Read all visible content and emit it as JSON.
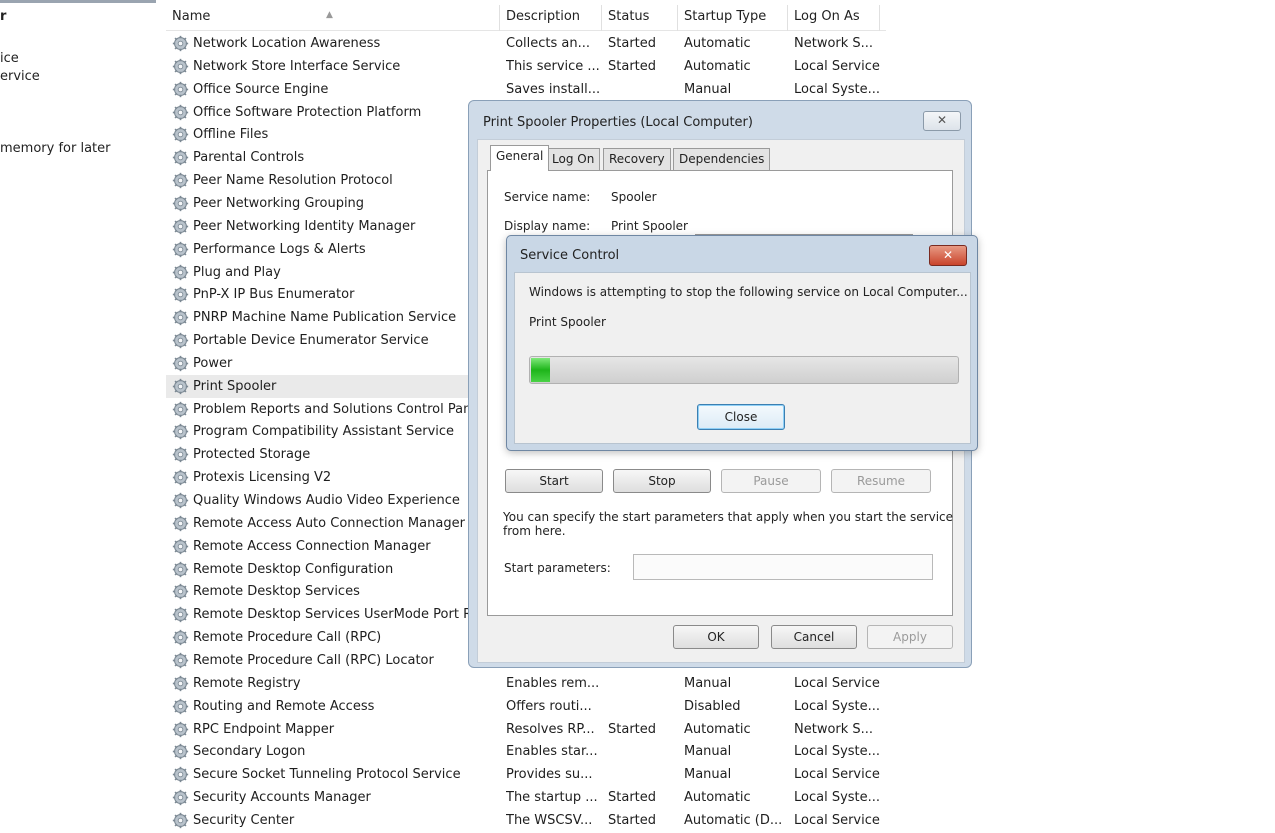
{
  "left_pane": {
    "heading": "r",
    "line1": "ice",
    "line2": "ervice",
    "line3": " memory for later"
  },
  "columns": [
    "Name",
    "Description",
    "Status",
    "Startup Type",
    "Log On As"
  ],
  "services": [
    {
      "name": "Network Location Awareness",
      "description": "Collects an...",
      "status": "Started",
      "startup": "Automatic",
      "logon": "Network S..."
    },
    {
      "name": "Network Store Interface Service",
      "description": "This service ...",
      "status": "Started",
      "startup": "Automatic",
      "logon": "Local Service"
    },
    {
      "name": "Office  Source Engine",
      "description": "Saves install...",
      "status": "",
      "startup": "Manual",
      "logon": "Local Syste..."
    },
    {
      "name": "Office Software Protection Platform",
      "description": "",
      "status": "",
      "startup": "",
      "logon": ""
    },
    {
      "name": "Offline Files",
      "description": "",
      "status": "",
      "startup": "",
      "logon": ""
    },
    {
      "name": "Parental Controls",
      "description": "",
      "status": "",
      "startup": "",
      "logon": ""
    },
    {
      "name": "Peer Name Resolution Protocol",
      "description": "",
      "status": "",
      "startup": "",
      "logon": ""
    },
    {
      "name": "Peer Networking Grouping",
      "description": "",
      "status": "",
      "startup": "",
      "logon": ""
    },
    {
      "name": "Peer Networking Identity Manager",
      "description": "",
      "status": "",
      "startup": "",
      "logon": ""
    },
    {
      "name": "Performance Logs & Alerts",
      "description": "",
      "status": "",
      "startup": "",
      "logon": ""
    },
    {
      "name": "Plug and Play",
      "description": "",
      "status": "",
      "startup": "",
      "logon": ""
    },
    {
      "name": "PnP-X IP Bus Enumerator",
      "description": "",
      "status": "",
      "startup": "",
      "logon": ""
    },
    {
      "name": "PNRP Machine Name Publication Service",
      "description": "",
      "status": "",
      "startup": "",
      "logon": ""
    },
    {
      "name": "Portable Device Enumerator Service",
      "description": "",
      "status": "",
      "startup": "",
      "logon": ""
    },
    {
      "name": "Power",
      "description": "",
      "status": "",
      "startup": "",
      "logon": ""
    },
    {
      "name": "Print Spooler",
      "description": "",
      "status": "",
      "startup": "",
      "logon": "",
      "selected": true
    },
    {
      "name": "Problem Reports and Solutions Control Pan",
      "description": "",
      "status": "",
      "startup": "",
      "logon": ""
    },
    {
      "name": "Program Compatibility Assistant Service",
      "description": "",
      "status": "",
      "startup": "",
      "logon": ""
    },
    {
      "name": "Protected Storage",
      "description": "",
      "status": "",
      "startup": "",
      "logon": ""
    },
    {
      "name": "Protexis Licensing V2",
      "description": "",
      "status": "",
      "startup": "",
      "logon": ""
    },
    {
      "name": "Quality Windows Audio Video Experience",
      "description": "",
      "status": "",
      "startup": "",
      "logon": ""
    },
    {
      "name": "Remote Access Auto Connection Manager",
      "description": "",
      "status": "",
      "startup": "",
      "logon": ""
    },
    {
      "name": "Remote Access Connection Manager",
      "description": "",
      "status": "",
      "startup": "",
      "logon": ""
    },
    {
      "name": "Remote Desktop Configuration",
      "description": "",
      "status": "",
      "startup": "",
      "logon": ""
    },
    {
      "name": "Remote Desktop Services",
      "description": "",
      "status": "",
      "startup": "",
      "logon": ""
    },
    {
      "name": "Remote Desktop Services UserMode Port Re",
      "description": "",
      "status": "",
      "startup": "",
      "logon": ""
    },
    {
      "name": "Remote Procedure Call (RPC)",
      "description": "",
      "status": "",
      "startup": "",
      "logon": ""
    },
    {
      "name": "Remote Procedure Call (RPC) Locator",
      "description": "",
      "status": "",
      "startup": "",
      "logon": ""
    },
    {
      "name": "Remote Registry",
      "description": "Enables rem...",
      "status": "",
      "startup": "Manual",
      "logon": "Local Service"
    },
    {
      "name": "Routing and Remote Access",
      "description": "Offers routi...",
      "status": "",
      "startup": "Disabled",
      "logon": "Local Syste..."
    },
    {
      "name": "RPC Endpoint Mapper",
      "description": "Resolves RP...",
      "status": "Started",
      "startup": "Automatic",
      "logon": "Network S..."
    },
    {
      "name": "Secondary Logon",
      "description": "Enables star...",
      "status": "",
      "startup": "Manual",
      "logon": "Local Syste..."
    },
    {
      "name": "Secure Socket Tunneling Protocol Service",
      "description": "Provides su...",
      "status": "",
      "startup": "Manual",
      "logon": "Local Service"
    },
    {
      "name": "Security Accounts Manager",
      "description": "The startup ...",
      "status": "Started",
      "startup": "Automatic",
      "logon": "Local Syste..."
    },
    {
      "name": "Security Center",
      "description": "The WSCSV...",
      "status": "Started",
      "startup": "Automatic (D...",
      "logon": "Local Service"
    }
  ],
  "properties_dialog": {
    "title": "Print Spooler Properties (Local Computer)",
    "close_glyph": "✕",
    "tabs": [
      "General",
      "Log On",
      "Recovery",
      "Dependencies"
    ],
    "service_name_label": "Service name:",
    "service_name_value": "Spooler",
    "display_name_label": "Display name:",
    "display_name_value": "Print Spooler",
    "buttons": {
      "start": "Start",
      "stop": "Stop",
      "pause": "Pause",
      "resume": "Resume"
    },
    "info_text_1": "You can specify the start parameters that apply when you start the service",
    "info_text_2": "from here.",
    "start_params_label": "Start parameters:",
    "footer": {
      "ok": "OK",
      "cancel": "Cancel",
      "apply": "Apply"
    }
  },
  "service_control_dialog": {
    "title": "Service Control",
    "close_glyph": "✕",
    "message": "Windows is attempting to stop the following service on Local Computer...",
    "service": "Print Spooler",
    "progress_fraction": 0.045,
    "close_label": "Close"
  },
  "colors": {
    "progress_green": "#1eb51a",
    "close_red": "#c9442c",
    "dialog_frame": "#cfdbe8"
  }
}
